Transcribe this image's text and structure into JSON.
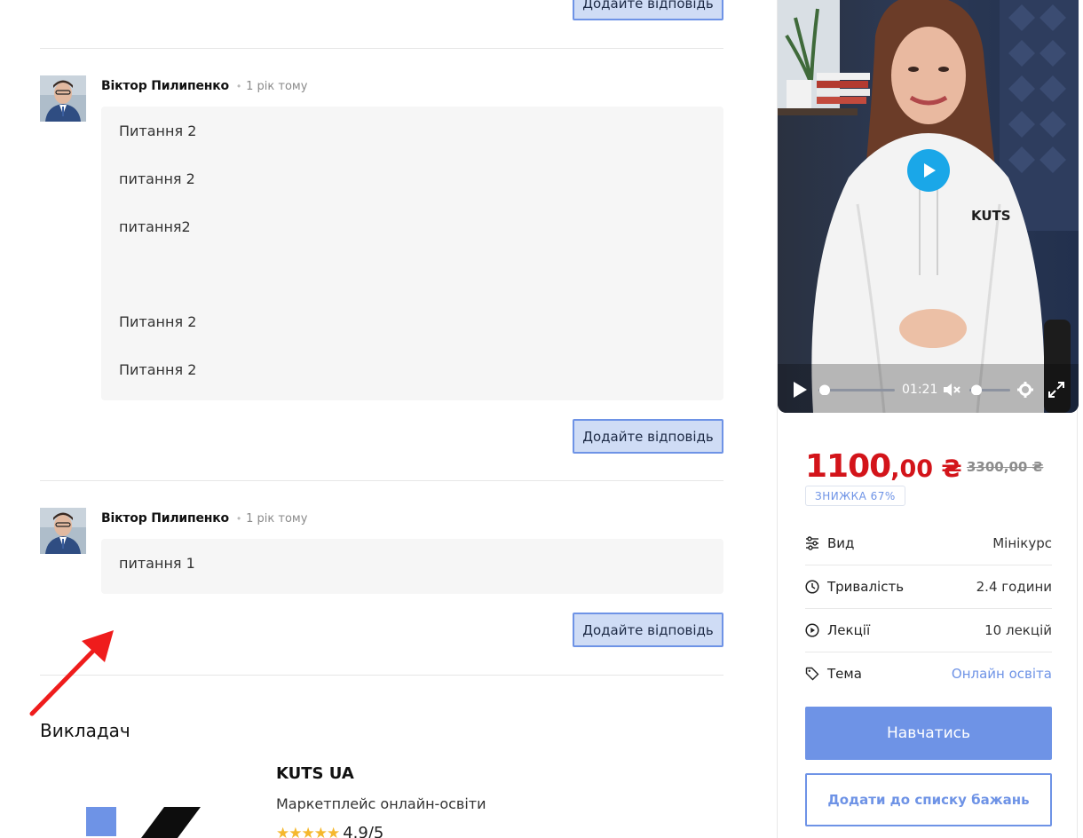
{
  "comments": [
    {
      "author": "Віктор Пилипенко",
      "time": "1 рік тому",
      "lines": [
        "Питання 2",
        "питання 2",
        "питання2",
        "Питання 2",
        "Питання 2"
      ]
    },
    {
      "author": "Віктор Пилипенко",
      "time": "1 рік тому",
      "lines": [
        "питання 1"
      ]
    }
  ],
  "reply_label": "Додайте відповідь",
  "instructor": {
    "section_title": "Викладач",
    "name": "KUTS UA",
    "description": "Маркетплейс онлайн-освіти",
    "rating_text": "4.9/5",
    "rating": 4.9
  },
  "video": {
    "current_time": "01:21",
    "brand_text": "KUTS"
  },
  "pricing": {
    "price_main": "1100",
    "price_cents": ",00 ₴",
    "old_price": "3300,00 ₴",
    "discount_badge": "ЗНИЖКА 67%"
  },
  "details": [
    {
      "icon": "sliders-icon",
      "label": "Вид",
      "value": "Мінікурс",
      "link": false
    },
    {
      "icon": "clock-icon",
      "label": "Тривалість",
      "value": "2.4 години",
      "link": false
    },
    {
      "icon": "play-circle-icon",
      "label": "Лекції",
      "value": "10 лекцій",
      "link": false
    },
    {
      "icon": "tag-icon",
      "label": "Тема",
      "value": "Онлайн освіта",
      "link": true
    }
  ],
  "actions": {
    "enroll": "Навчатись",
    "wishlist": "Додати до списку бажань"
  },
  "colors": {
    "accent": "#6e93e6",
    "price_red": "#d3141a",
    "reply_bg": "#cfdcf5"
  }
}
